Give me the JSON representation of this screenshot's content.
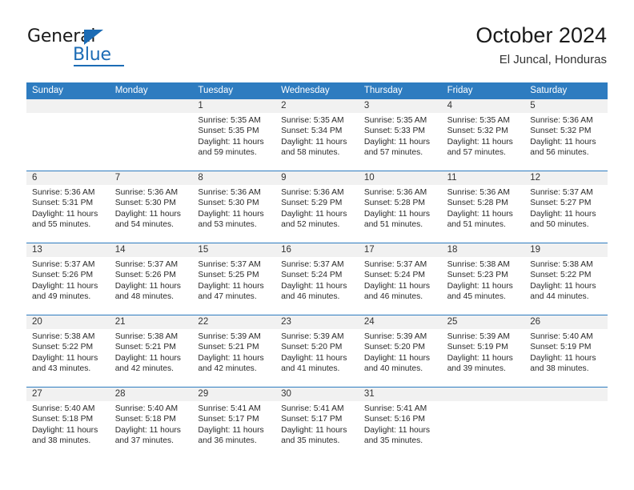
{
  "brand": {
    "name_part1": "General",
    "name_part2": "Blue",
    "accent_color": "#1c6cb5"
  },
  "header": {
    "title": "October 2024",
    "subtitle": "El Juncal, Honduras"
  },
  "calendar": {
    "header_color": "#2e7cc0",
    "weekdays": [
      "Sunday",
      "Monday",
      "Tuesday",
      "Wednesday",
      "Thursday",
      "Friday",
      "Saturday"
    ],
    "labels": {
      "sunrise": "Sunrise:",
      "sunset": "Sunset:",
      "daylight": "Daylight:"
    },
    "weeks": [
      [
        {
          "day": "",
          "empty": true
        },
        {
          "day": "",
          "empty": true
        },
        {
          "day": "1",
          "sunrise": "Sunrise: 5:35 AM",
          "sunset": "Sunset: 5:35 PM",
          "daylight": "Daylight: 11 hours and 59 minutes."
        },
        {
          "day": "2",
          "sunrise": "Sunrise: 5:35 AM",
          "sunset": "Sunset: 5:34 PM",
          "daylight": "Daylight: 11 hours and 58 minutes."
        },
        {
          "day": "3",
          "sunrise": "Sunrise: 5:35 AM",
          "sunset": "Sunset: 5:33 PM",
          "daylight": "Daylight: 11 hours and 57 minutes."
        },
        {
          "day": "4",
          "sunrise": "Sunrise: 5:35 AM",
          "sunset": "Sunset: 5:32 PM",
          "daylight": "Daylight: 11 hours and 57 minutes."
        },
        {
          "day": "5",
          "sunrise": "Sunrise: 5:36 AM",
          "sunset": "Sunset: 5:32 PM",
          "daylight": "Daylight: 11 hours and 56 minutes."
        }
      ],
      [
        {
          "day": "6",
          "sunrise": "Sunrise: 5:36 AM",
          "sunset": "Sunset: 5:31 PM",
          "daylight": "Daylight: 11 hours and 55 minutes."
        },
        {
          "day": "7",
          "sunrise": "Sunrise: 5:36 AM",
          "sunset": "Sunset: 5:30 PM",
          "daylight": "Daylight: 11 hours and 54 minutes."
        },
        {
          "day": "8",
          "sunrise": "Sunrise: 5:36 AM",
          "sunset": "Sunset: 5:30 PM",
          "daylight": "Daylight: 11 hours and 53 minutes."
        },
        {
          "day": "9",
          "sunrise": "Sunrise: 5:36 AM",
          "sunset": "Sunset: 5:29 PM",
          "daylight": "Daylight: 11 hours and 52 minutes."
        },
        {
          "day": "10",
          "sunrise": "Sunrise: 5:36 AM",
          "sunset": "Sunset: 5:28 PM",
          "daylight": "Daylight: 11 hours and 51 minutes."
        },
        {
          "day": "11",
          "sunrise": "Sunrise: 5:36 AM",
          "sunset": "Sunset: 5:28 PM",
          "daylight": "Daylight: 11 hours and 51 minutes."
        },
        {
          "day": "12",
          "sunrise": "Sunrise: 5:37 AM",
          "sunset": "Sunset: 5:27 PM",
          "daylight": "Daylight: 11 hours and 50 minutes."
        }
      ],
      [
        {
          "day": "13",
          "sunrise": "Sunrise: 5:37 AM",
          "sunset": "Sunset: 5:26 PM",
          "daylight": "Daylight: 11 hours and 49 minutes."
        },
        {
          "day": "14",
          "sunrise": "Sunrise: 5:37 AM",
          "sunset": "Sunset: 5:26 PM",
          "daylight": "Daylight: 11 hours and 48 minutes."
        },
        {
          "day": "15",
          "sunrise": "Sunrise: 5:37 AM",
          "sunset": "Sunset: 5:25 PM",
          "daylight": "Daylight: 11 hours and 47 minutes."
        },
        {
          "day": "16",
          "sunrise": "Sunrise: 5:37 AM",
          "sunset": "Sunset: 5:24 PM",
          "daylight": "Daylight: 11 hours and 46 minutes."
        },
        {
          "day": "17",
          "sunrise": "Sunrise: 5:37 AM",
          "sunset": "Sunset: 5:24 PM",
          "daylight": "Daylight: 11 hours and 46 minutes."
        },
        {
          "day": "18",
          "sunrise": "Sunrise: 5:38 AM",
          "sunset": "Sunset: 5:23 PM",
          "daylight": "Daylight: 11 hours and 45 minutes."
        },
        {
          "day": "19",
          "sunrise": "Sunrise: 5:38 AM",
          "sunset": "Sunset: 5:22 PM",
          "daylight": "Daylight: 11 hours and 44 minutes."
        }
      ],
      [
        {
          "day": "20",
          "sunrise": "Sunrise: 5:38 AM",
          "sunset": "Sunset: 5:22 PM",
          "daylight": "Daylight: 11 hours and 43 minutes."
        },
        {
          "day": "21",
          "sunrise": "Sunrise: 5:38 AM",
          "sunset": "Sunset: 5:21 PM",
          "daylight": "Daylight: 11 hours and 42 minutes."
        },
        {
          "day": "22",
          "sunrise": "Sunrise: 5:39 AM",
          "sunset": "Sunset: 5:21 PM",
          "daylight": "Daylight: 11 hours and 42 minutes."
        },
        {
          "day": "23",
          "sunrise": "Sunrise: 5:39 AM",
          "sunset": "Sunset: 5:20 PM",
          "daylight": "Daylight: 11 hours and 41 minutes."
        },
        {
          "day": "24",
          "sunrise": "Sunrise: 5:39 AM",
          "sunset": "Sunset: 5:20 PM",
          "daylight": "Daylight: 11 hours and 40 minutes."
        },
        {
          "day": "25",
          "sunrise": "Sunrise: 5:39 AM",
          "sunset": "Sunset: 5:19 PM",
          "daylight": "Daylight: 11 hours and 39 minutes."
        },
        {
          "day": "26",
          "sunrise": "Sunrise: 5:40 AM",
          "sunset": "Sunset: 5:19 PM",
          "daylight": "Daylight: 11 hours and 38 minutes."
        }
      ],
      [
        {
          "day": "27",
          "sunrise": "Sunrise: 5:40 AM",
          "sunset": "Sunset: 5:18 PM",
          "daylight": "Daylight: 11 hours and 38 minutes."
        },
        {
          "day": "28",
          "sunrise": "Sunrise: 5:40 AM",
          "sunset": "Sunset: 5:18 PM",
          "daylight": "Daylight: 11 hours and 37 minutes."
        },
        {
          "day": "29",
          "sunrise": "Sunrise: 5:41 AM",
          "sunset": "Sunset: 5:17 PM",
          "daylight": "Daylight: 11 hours and 36 minutes."
        },
        {
          "day": "30",
          "sunrise": "Sunrise: 5:41 AM",
          "sunset": "Sunset: 5:17 PM",
          "daylight": "Daylight: 11 hours and 35 minutes."
        },
        {
          "day": "31",
          "sunrise": "Sunrise: 5:41 AM",
          "sunset": "Sunset: 5:16 PM",
          "daylight": "Daylight: 11 hours and 35 minutes."
        },
        {
          "day": "",
          "empty": true
        },
        {
          "day": "",
          "empty": true
        }
      ]
    ]
  }
}
